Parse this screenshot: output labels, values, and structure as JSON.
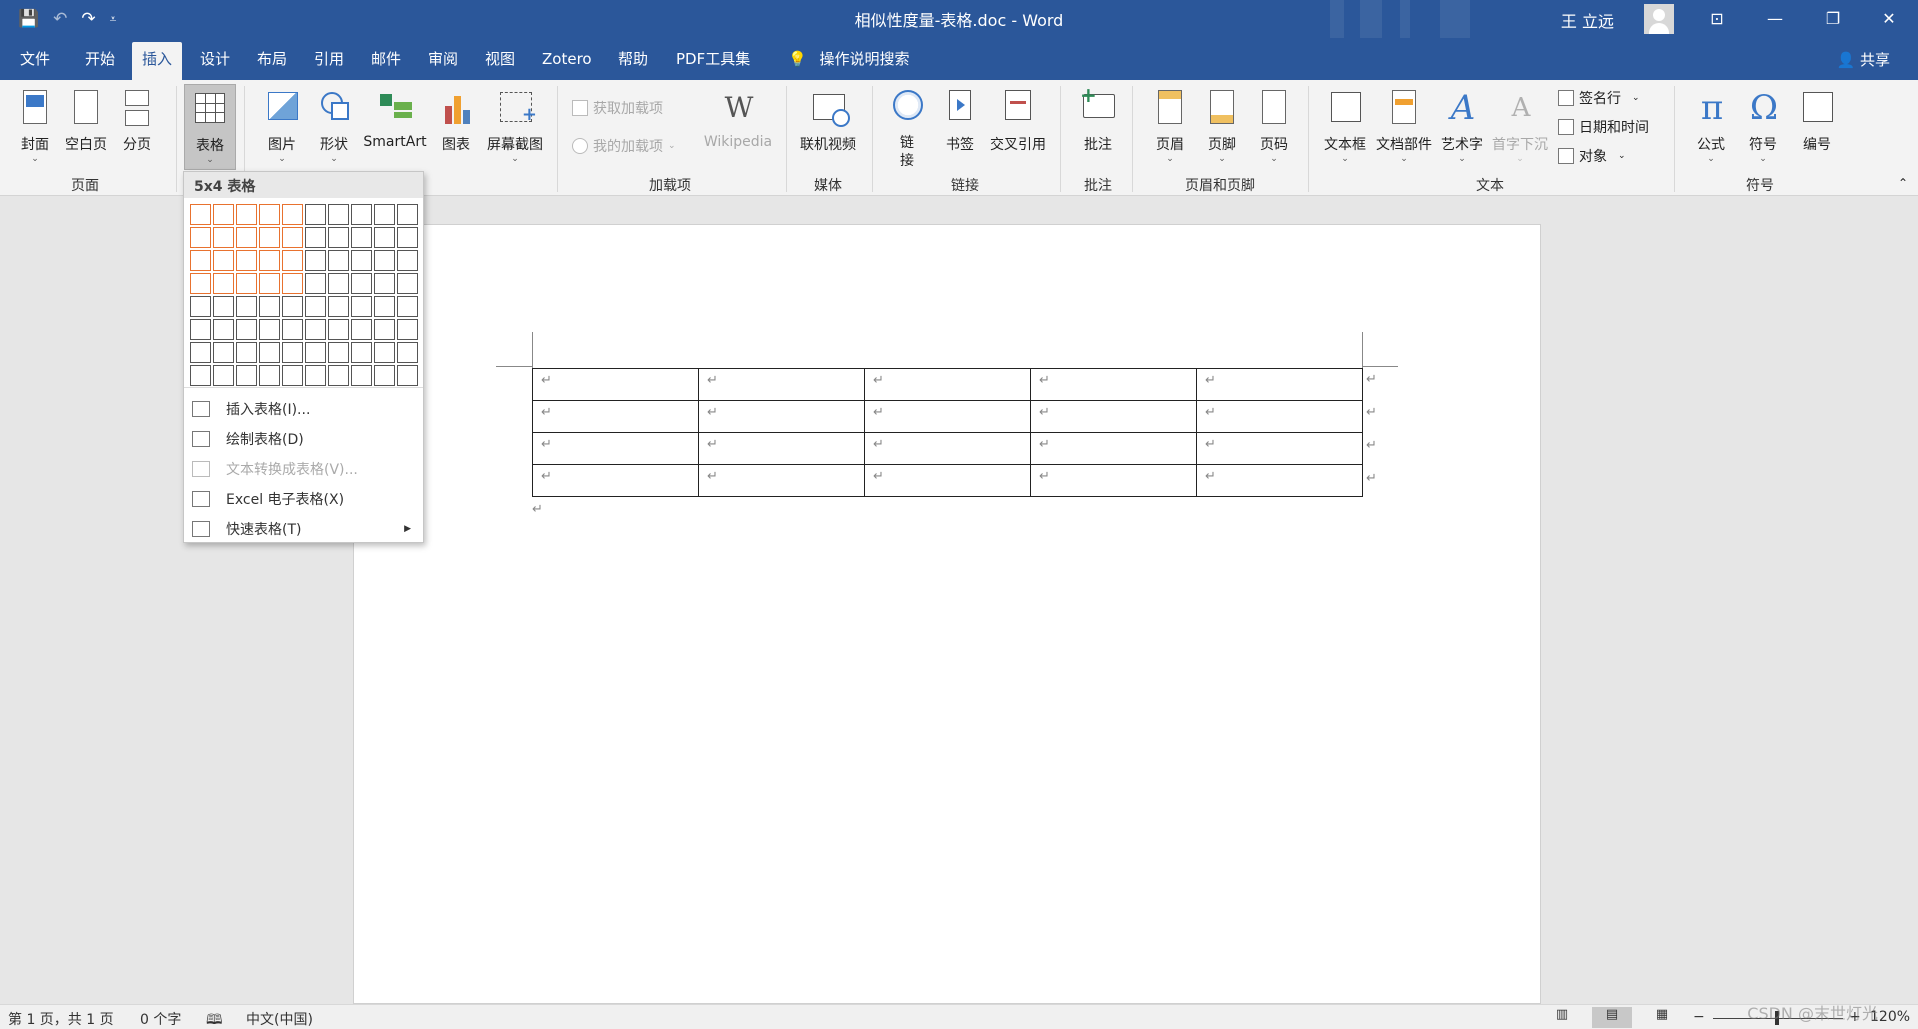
{
  "titlebar": {
    "title": "相似性度量-表格.doc  -  Word",
    "user": "王 立远",
    "qat": {
      "save": "💾",
      "undo": "↶",
      "redo": "↷",
      "customize": "⩡"
    },
    "controls": {
      "ribbon_options": "⊡",
      "minimize": "—",
      "restore": "❐",
      "close": "✕"
    }
  },
  "tabs": [
    {
      "label": "文件"
    },
    {
      "label": "开始"
    },
    {
      "label": "插入"
    },
    {
      "label": "设计"
    },
    {
      "label": "布局"
    },
    {
      "label": "引用"
    },
    {
      "label": "邮件"
    },
    {
      "label": "审阅"
    },
    {
      "label": "视图"
    },
    {
      "label": "Zotero"
    },
    {
      "label": "帮助"
    },
    {
      "label": "PDF工具集"
    },
    {
      "label": "操作说明搜索"
    }
  ],
  "share": "共享",
  "ribbon": {
    "pages": {
      "cover": "封面",
      "blank": "空白页",
      "break": "分页",
      "group": "页面"
    },
    "tables": {
      "table": "表格"
    },
    "illustrations": {
      "picture": "图片",
      "shapes": "形状",
      "smartart": "SmartArt",
      "chart": "图表",
      "screenshot": "屏幕截图"
    },
    "addins": {
      "get": "获取加载项",
      "mine": "我的加载项",
      "wikipedia": "Wikipedia",
      "wiki_glyph": "W",
      "group": "加载项"
    },
    "media": {
      "video": "联机视频",
      "group": "媒体"
    },
    "links": {
      "link": "链接",
      "bookmark": "书签",
      "xref": "交叉引用",
      "group": "链接"
    },
    "comments": {
      "comment": "批注",
      "group": "批注"
    },
    "headerfooter": {
      "header": "页眉",
      "footer": "页脚",
      "pagenum": "页码",
      "group": "页眉和页脚"
    },
    "text": {
      "textbox": "文本框",
      "parts": "文档部件",
      "wordart": "艺术字",
      "wordart_glyph": "A",
      "dropcap": "首字下沉",
      "dropcap_glyph": "A",
      "sigline": "签名行",
      "datetime": "日期和时间",
      "object": "对象",
      "group": "文本"
    },
    "symbols": {
      "equation": "公式",
      "equation_glyph": "π",
      "symbol": "符号",
      "symbol_glyph": "Ω",
      "number": "编号",
      "group": "符号"
    }
  },
  "dropdown": {
    "header": "5x4 表格",
    "grid_cols": 10,
    "grid_rows": 8,
    "selected_cols": 5,
    "selected_rows": 4,
    "items": [
      {
        "label": "插入表格(I)...",
        "enabled": true
      },
      {
        "label": "绘制表格(D)",
        "enabled": true
      },
      {
        "label": "文本转换成表格(V)...",
        "enabled": false
      },
      {
        "label": "Excel 电子表格(X)",
        "enabled": true
      },
      {
        "label": "快速表格(T)",
        "enabled": true
      }
    ]
  },
  "document": {
    "table": {
      "rows": 4,
      "cols": 5,
      "cell_mark": "↵"
    },
    "paragraph_mark": "↵"
  },
  "statusbar": {
    "page": "第 1 页，共 1 页",
    "words": "0 个字",
    "language": "中文(中国)",
    "zoom": "120%",
    "zoom_level": 1.2
  },
  "watermark": "CSDN @末世灯光"
}
